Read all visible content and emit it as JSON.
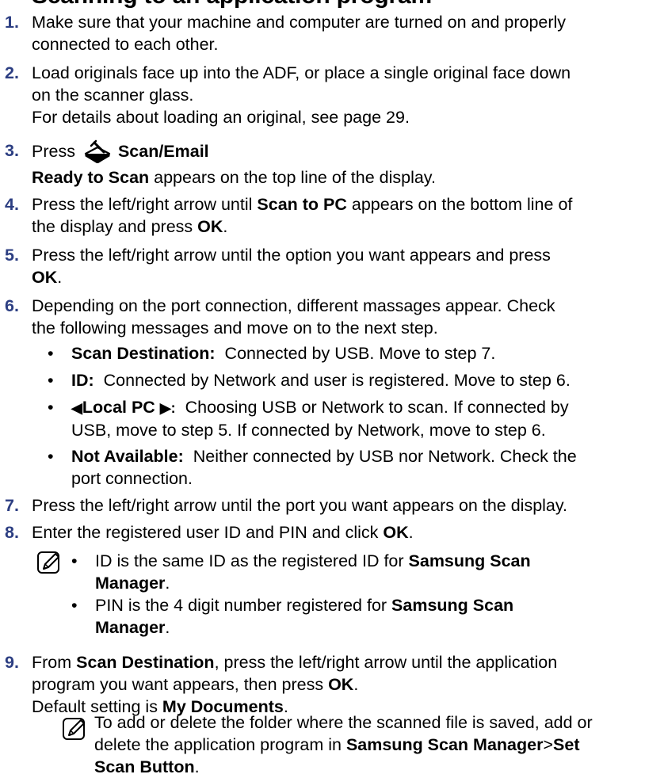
{
  "heading": "Scanning to an application program",
  "steps": [
    {
      "num": "1.",
      "lines": [
        "Make sure that your machine and computer are turned on and properly",
        "connected to each other."
      ]
    },
    {
      "num": "2.",
      "lines": [
        "Load originals face up into the ADF, or place a single original face down",
        "on the scanner glass.",
        "For details about loading an original, see page 29."
      ]
    },
    {
      "num": "3.",
      "press": "Press",
      "button_label": "Scan/Email",
      "line2_bold": "Ready to Scan",
      "line2_rest": " appears on the top line of the display."
    },
    {
      "num": "4.",
      "l1a": "Press the left/right arrow until ",
      "l1b": "Scan to PC",
      "l1c": " appears on the bottom line of",
      "l2a": "the display and press ",
      "l2b": "OK",
      "l2c": "."
    },
    {
      "num": "5.",
      "l1": "Press the left/right arrow until the option you want appears and press",
      "l2b": "OK",
      "l2c": "."
    },
    {
      "num": "6.",
      "lines": [
        "Depending on the port connection, different massages appear. Check",
        "the following messages and move on to the next step."
      ]
    },
    {
      "num": "7.",
      "text": "Press the left/right arrow until the port you want appears on the display."
    },
    {
      "num": "8.",
      "ta": "Enter the registered user ID and PIN and click ",
      "tb": "OK",
      "tc": "."
    },
    {
      "num": "9.",
      "l1a": "From ",
      "l1b": "Scan Destination",
      "l1c": ", press the left/right arrow until the application",
      "l2a": "program you want appears, then press ",
      "l2b": "OK",
      "l2c": ".",
      "l3a": "Default setting is ",
      "l3b": "My Documents",
      "l3c": "."
    }
  ],
  "bullets": [
    {
      "label": "Scan Destination:",
      "lines": [
        "Connected by USB. Move to step 7."
      ]
    },
    {
      "label": "ID:",
      "lines": [
        "Connected by Network and user is registered. Move to step 6."
      ]
    },
    {
      "label_left_arrow": "◀",
      "label": "Local PC ",
      "label_right_arrow": "▶:",
      "lines": [
        "Choosing USB or Network to scan. If connected by",
        "USB, move to step 5. If connected by Network, move to step 6."
      ]
    },
    {
      "label": "Not Available:",
      "lines": [
        "Neither connected by USB nor Network. Check the",
        "port connection."
      ]
    }
  ],
  "note1": [
    {
      "a": "ID is the same ID as the registered ID for ",
      "b": "Samsung Scan",
      "c": "Manager",
      "d": "."
    },
    {
      "a": "PIN is the 4 digit number registered for ",
      "b": "Samsung Scan",
      "c": "Manager",
      "d": "."
    }
  ],
  "note2": {
    "l1": "To add or delete the folder where the scanned file is saved, add or",
    "l2a": "delete the application program in ",
    "l2b": "Samsung Scan Manager",
    "l2c": ">",
    "l2d": "Set",
    "l3b": "Scan Button",
    "l3c": "."
  },
  "bullet_char": "•"
}
